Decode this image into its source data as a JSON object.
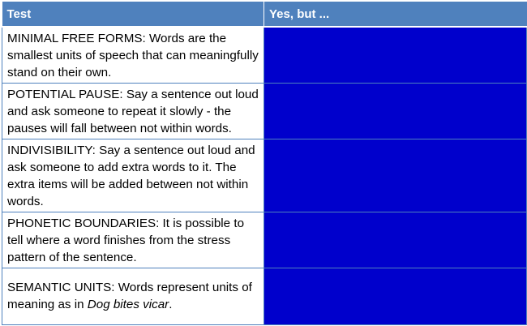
{
  "table": {
    "headers": [
      "Test",
      "Yes, but ..."
    ],
    "rows": [
      {
        "test": "MINIMAL FREE FORMS: Words are the smallest units of speech that can meaningfully stand on their own.",
        "answer": ""
      },
      {
        "test": "POTENTIAL PAUSE: Say a sentence out loud and ask someone to repeat it slowly - the pauses will fall between not within words.",
        "answer": ""
      },
      {
        "test": "INDIVISIBILITY: Say a sentence out loud and ask someone to add extra words to it.  The extra items will be added between not within words.",
        "answer": ""
      },
      {
        "test": "PHONETIC BOUNDARIES: It is possible to tell where a word finishes from the stress pattern of the sentence.",
        "answer": ""
      },
      {
        "test_prefix": "SEMANTIC UNITS: Words represent units of meaning as in ",
        "test_emphasis": "Dog bites vicar",
        "test_suffix": ".",
        "answer": ""
      }
    ]
  },
  "colors": {
    "header_bg": "#4f81bd",
    "answer_cell_bg": "#0000cc",
    "border": "#4f81bd"
  }
}
